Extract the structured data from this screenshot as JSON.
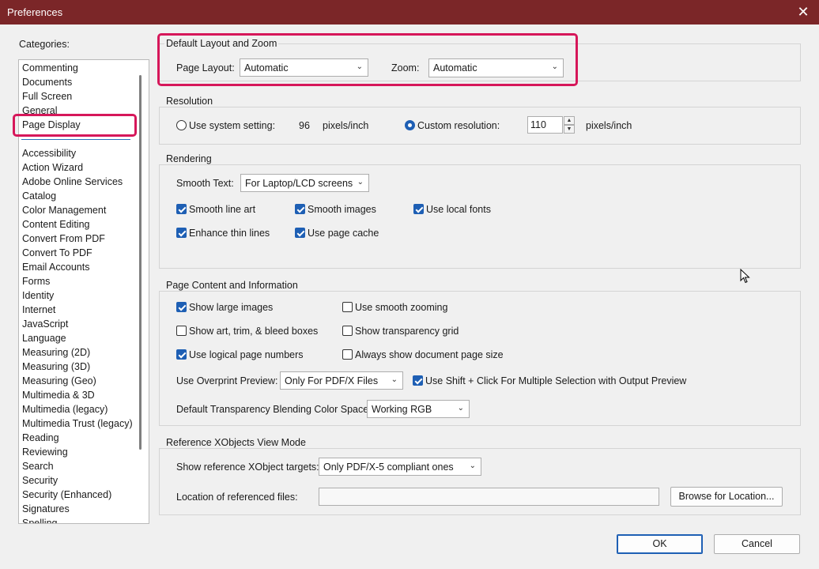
{
  "window": {
    "title": "Preferences",
    "close_glyph": "✕"
  },
  "categories": {
    "label": "Categories:",
    "top_items": [
      "Commenting",
      "Documents",
      "Full Screen",
      "General",
      "Page Display"
    ],
    "items": [
      "Accessibility",
      "Action Wizard",
      "Adobe Online Services",
      "Catalog",
      "Color Management",
      "Content Editing",
      "Convert From PDF",
      "Convert To PDF",
      "Email Accounts",
      "Forms",
      "Identity",
      "Internet",
      "JavaScript",
      "Language",
      "Measuring (2D)",
      "Measuring (3D)",
      "Measuring (Geo)",
      "Multimedia & 3D",
      "Multimedia (legacy)",
      "Multimedia Trust (legacy)",
      "Reading",
      "Reviewing",
      "Search",
      "Security",
      "Security (Enhanced)",
      "Signatures",
      "Spelling"
    ],
    "selected": "Page Display"
  },
  "layout_zoom": {
    "title": "Default Layout and Zoom",
    "page_layout_label": "Page Layout:",
    "page_layout_value": "Automatic",
    "zoom_label": "Zoom:",
    "zoom_value": "Automatic"
  },
  "resolution": {
    "title": "Resolution",
    "system_label": "Use system setting:",
    "system_value": "96",
    "system_unit": "pixels/inch",
    "custom_label": "Custom resolution:",
    "custom_value": "110",
    "custom_unit": "pixels/inch",
    "selected": "custom"
  },
  "rendering": {
    "title": "Rendering",
    "smooth_text_label": "Smooth Text:",
    "smooth_text_value": "For Laptop/LCD screens",
    "smooth_line_art": "Smooth line art",
    "smooth_images": "Smooth images",
    "use_local_fonts": "Use local fonts",
    "enhance_thin_lines": "Enhance thin lines",
    "use_page_cache": "Use page cache"
  },
  "page_content": {
    "title": "Page Content and Information",
    "show_large_images": "Show large images",
    "use_smooth_zooming": "Use smooth zooming",
    "show_art_trim": "Show art, trim, & bleed boxes",
    "show_transparency_grid": "Show transparency grid",
    "use_logical_page_numbers": "Use logical page numbers",
    "always_show_page_size": "Always show document page size",
    "overprint_label": "Use Overprint Preview:",
    "overprint_value": "Only For PDF/X Files",
    "shift_click": "Use Shift + Click For Multiple Selection with Output Preview",
    "blending_label": "Default Transparency Blending Color Space:",
    "blending_value": "Working RGB"
  },
  "xobjects": {
    "title": "Reference XObjects View Mode",
    "targets_label": "Show reference XObject targets:",
    "targets_value": "Only PDF/X-5 compliant ones",
    "location_label": "Location of referenced files:",
    "location_value": "",
    "browse_label": "Browse for Location..."
  },
  "footer": {
    "ok": "OK",
    "cancel": "Cancel"
  },
  "colors": {
    "titlebar": "#7b2628",
    "highlight": "#d6175a",
    "accent": "#1e5fb4"
  }
}
